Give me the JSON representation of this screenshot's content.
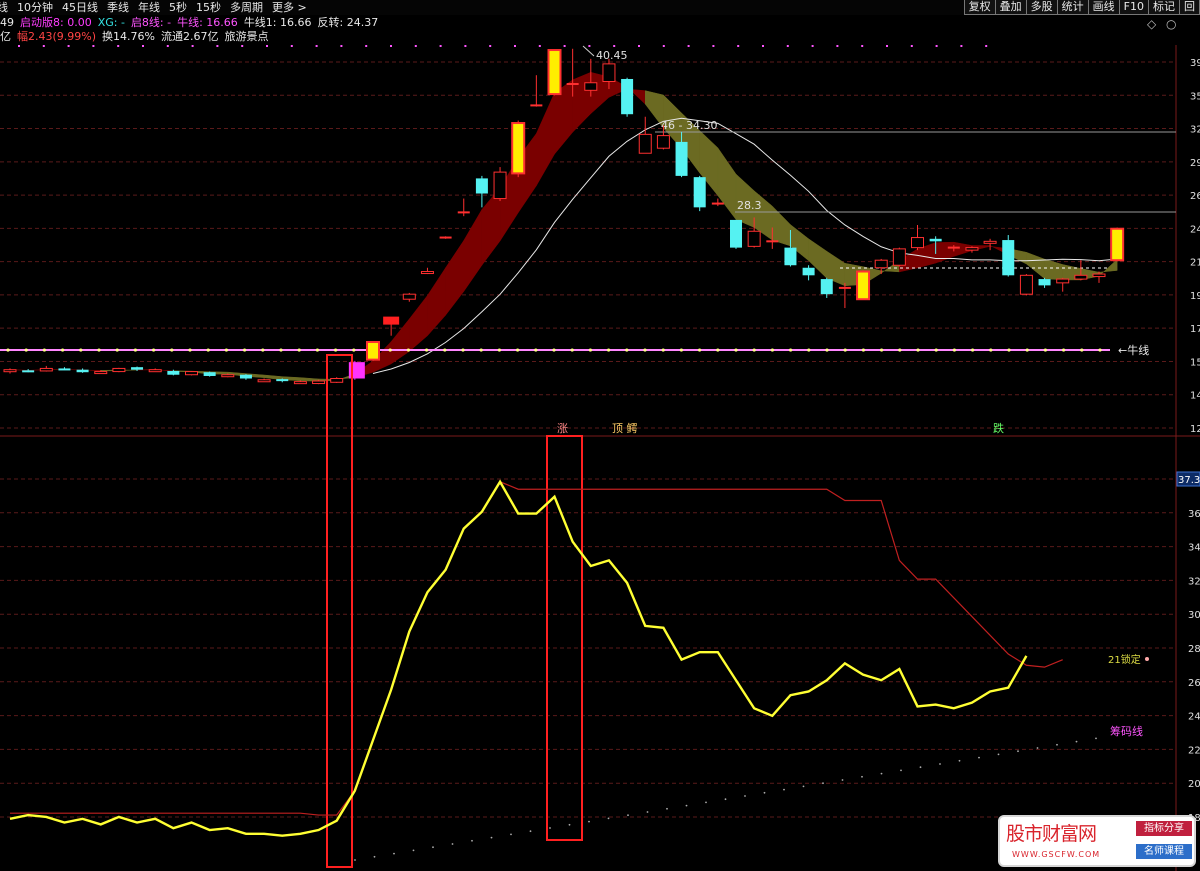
{
  "toolbar": {
    "tabs": [
      "线",
      "10分钟",
      "45日线",
      "季线",
      "年线",
      "5秒",
      "15秒",
      "多周期",
      "更多 >"
    ],
    "right_buttons": [
      "复权",
      "叠加",
      "多股",
      "统计",
      "画线",
      "F10",
      "标记",
      "回"
    ]
  },
  "info_line1": [
    {
      "text": "49",
      "color": "#e8e8e8"
    },
    {
      "text": "启动版8: 0.00",
      "color": "#ff3dff"
    },
    {
      "text": "XG: -",
      "color": "#33e0e0"
    },
    {
      "text": "启8线: -",
      "color": "#ff55ff"
    },
    {
      "text": "牛线: 16.66",
      "color": "#ff55ff"
    },
    {
      "text": "牛线1: 16.66",
      "color": "#e8e8e8"
    },
    {
      "text": "反转: 24.37",
      "color": "#e8e8e8"
    }
  ],
  "info_line2": [
    {
      "text": "亿",
      "color": "#e8e8e8"
    },
    {
      "text": "幅2.43(9.99%)",
      "color": "#ff4444"
    },
    {
      "text": "换14.76%",
      "color": "#e8e8e8"
    },
    {
      "text": "流通2.67亿",
      "color": "#e8e8e8"
    },
    {
      "text": "旅游景点",
      "color": "#e8e8e8"
    }
  ],
  "annotations": {
    "high_label": "40.45",
    "resistance_label": "46 - 34.30",
    "mid_label": "28.3",
    "bull_line_label": "←牛线",
    "signal_up": "涨",
    "signal_mid": "顶 鳄",
    "signal_down": "跌",
    "chip_line_label": "筹码线",
    "current_value_label": "37.3",
    "osc_end_label": "21锁定"
  },
  "price_axis_labels": [
    "39",
    "35",
    "32",
    "29",
    "26",
    "24",
    "21",
    "19",
    "17",
    "15",
    "14",
    "12"
  ],
  "osc_axis_labels": [
    "37.3",
    "36",
    "34",
    "32",
    "30",
    "28",
    "26",
    "24",
    "22",
    "20",
    "18"
  ],
  "colors": {
    "bg": "#000000",
    "grid": "#5a1a1a",
    "up": "#ff3030",
    "down": "#55f2f2",
    "limit_up": "#ffee00",
    "osc_line": "#ffff33",
    "red_line": "#c02020",
    "bull_line": "#ff88ff",
    "ribbon_up": "#7a0000",
    "ribbon_down": "#6b6a22"
  },
  "chart_data": {
    "type": "candlestick",
    "ylim_price": [
      11.5,
      40.9
    ],
    "ylim_osc": [
      17.0,
      37.4
    ],
    "bull_line_value": 16.66,
    "reversal_value": 24.37,
    "candles": [
      {
        "o": 14.95,
        "c": 15.1,
        "h": 15.2,
        "l": 14.8
      },
      {
        "o": 15.05,
        "c": 15.0,
        "h": 15.15,
        "l": 14.9
      },
      {
        "o": 15.0,
        "c": 15.2,
        "h": 15.4,
        "l": 14.95
      },
      {
        "o": 15.2,
        "c": 15.15,
        "h": 15.3,
        "l": 15.1
      },
      {
        "o": 15.1,
        "c": 14.9,
        "h": 15.2,
        "l": 14.85
      },
      {
        "o": 14.9,
        "c": 14.95,
        "h": 15.05,
        "l": 14.8
      },
      {
        "o": 14.95,
        "c": 15.2,
        "h": 15.25,
        "l": 14.9
      },
      {
        "o": 15.3,
        "c": 15.1,
        "h": 15.35,
        "l": 15.0
      },
      {
        "o": 15.1,
        "c": 15.1,
        "h": 15.2,
        "l": 15.0
      },
      {
        "o": 15.0,
        "c": 14.7,
        "h": 15.1,
        "l": 14.65
      },
      {
        "o": 14.7,
        "c": 14.95,
        "h": 15.0,
        "l": 14.65
      },
      {
        "o": 14.9,
        "c": 14.6,
        "h": 14.95,
        "l": 14.55
      },
      {
        "o": 14.6,
        "c": 14.7,
        "h": 14.8,
        "l": 14.5
      },
      {
        "o": 14.7,
        "c": 14.4,
        "h": 14.75,
        "l": 14.3
      },
      {
        "o": 14.3,
        "c": 14.3,
        "h": 14.4,
        "l": 14.2
      },
      {
        "o": 14.35,
        "c": 14.2,
        "h": 14.4,
        "l": 14.1
      },
      {
        "o": 14.1,
        "c": 14.15,
        "h": 14.25,
        "l": 14.0
      },
      {
        "o": 14.0,
        "c": 14.2,
        "h": 14.3,
        "l": 13.95
      },
      {
        "o": 14.1,
        "c": 14.4,
        "h": 14.5,
        "l": 14.05
      },
      {
        "o": 14.4,
        "c": 15.7,
        "h": 15.8,
        "l": 14.3,
        "special": "magenta"
      },
      {
        "o": 15.9,
        "c": 17.3,
        "h": 17.3,
        "l": 15.8
      },
      {
        "o": 19.0,
        "c": 19.0,
        "h": 19.2,
        "l": 17.8,
        "special": "redblock"
      },
      {
        "o": 20.7,
        "c": 21.1,
        "h": 21.2,
        "l": 20.5
      },
      {
        "o": 22.9,
        "c": 22.9,
        "h": 23.2,
        "l": 22.7
      },
      {
        "o": 25.6,
        "c": 25.6,
        "h": 25.7,
        "l": 25.5,
        "special": "dash"
      },
      {
        "o": 27.6,
        "c": 27.6,
        "h": 28.7,
        "l": 27.3,
        "special": "dash"
      },
      {
        "o": 29.1,
        "c": 30.3,
        "h": 30.5,
        "l": 28.0,
        "down": true
      },
      {
        "o": 28.7,
        "c": 30.8,
        "h": 31.2,
        "l": 28.5
      },
      {
        "o": 30.7,
        "c": 34.7,
        "h": 34.9,
        "l": 30.4
      },
      {
        "o": 36.1,
        "c": 36.1,
        "h": 38.5,
        "l": 36.0,
        "special": "dash"
      },
      {
        "o": 37.0,
        "c": 40.5,
        "h": 40.5,
        "l": 36.9
      },
      {
        "o": 37.8,
        "c": 37.8,
        "h": 40.6,
        "l": 36.8,
        "special": "dash"
      },
      {
        "o": 37.3,
        "c": 37.9,
        "h": 39.8,
        "l": 36.8
      },
      {
        "o": 38.0,
        "c": 39.4,
        "h": 39.8,
        "l": 37.4
      },
      {
        "o": 38.2,
        "c": 35.4,
        "h": 38.3,
        "l": 35.2,
        "down": true
      },
      {
        "o": 32.3,
        "c": 33.8,
        "h": 35.2,
        "l": 32.3
      },
      {
        "o": 32.7,
        "c": 33.7,
        "h": 34.5,
        "l": 32.6
      },
      {
        "o": 33.2,
        "c": 30.5,
        "h": 34.0,
        "l": 30.4,
        "down": true
      },
      {
        "o": 30.4,
        "c": 28.0,
        "h": 30.5,
        "l": 27.7,
        "down": true
      },
      {
        "o": 28.3,
        "c": 28.3,
        "h": 28.7,
        "l": 28.1,
        "special": "dash"
      },
      {
        "o": 27.0,
        "c": 24.8,
        "h": 27.0,
        "l": 24.7,
        "down": true
      },
      {
        "o": 24.9,
        "c": 26.1,
        "h": 27.2,
        "l": 24.8
      },
      {
        "o": 25.3,
        "c": 25.3,
        "h": 26.4,
        "l": 24.7,
        "special": "dash"
      },
      {
        "o": 24.8,
        "c": 23.4,
        "h": 26.2,
        "l": 23.3,
        "down": true
      },
      {
        "o": 23.2,
        "c": 22.6,
        "h": 23.4,
        "l": 22.2,
        "down": true
      },
      {
        "o": 22.3,
        "c": 21.1,
        "h": 22.4,
        "l": 20.8,
        "down": true
      },
      {
        "o": 21.6,
        "c": 21.6,
        "h": 22.0,
        "l": 20.0,
        "special": "dash"
      },
      {
        "o": 20.7,
        "c": 22.9,
        "h": 23.0,
        "l": 20.7
      },
      {
        "o": 23.2,
        "c": 23.8,
        "h": 23.9,
        "l": 22.7
      },
      {
        "o": 23.4,
        "c": 24.7,
        "h": 24.8,
        "l": 23.3
      },
      {
        "o": 24.8,
        "c": 25.6,
        "h": 26.6,
        "l": 24.6
      },
      {
        "o": 25.5,
        "c": 25.3,
        "h": 25.7,
        "l": 24.3,
        "down": true
      },
      {
        "o": 24.8,
        "c": 24.8,
        "h": 25.0,
        "l": 24.5,
        "special": "dash"
      },
      {
        "o": 24.6,
        "c": 24.8,
        "h": 24.9,
        "l": 24.4
      },
      {
        "o": 25.3,
        "c": 25.3,
        "h": 25.5,
        "l": 24.6
      },
      {
        "o": 25.4,
        "c": 22.6,
        "h": 25.8,
        "l": 22.5,
        "down": true
      },
      {
        "o": 21.1,
        "c": 22.6,
        "h": 22.7,
        "l": 21.0
      },
      {
        "o": 22.3,
        "c": 21.8,
        "h": 22.4,
        "l": 21.6,
        "down": true
      },
      {
        "o": 22.0,
        "c": 22.3,
        "h": 22.4,
        "l": 21.3
      },
      {
        "o": 22.3,
        "c": 22.6,
        "h": 23.8,
        "l": 22.2
      },
      {
        "o": 22.5,
        "c": 22.7,
        "h": 22.9,
        "l": 22.0
      },
      {
        "o": 23.8,
        "c": 26.3,
        "h": 26.4,
        "l": 23.7
      }
    ],
    "osc_line": [
      19.2,
      19.4,
      19.3,
      19.0,
      19.2,
      18.9,
      19.3,
      19.0,
      19.2,
      18.7,
      19.0,
      18.6,
      18.7,
      18.4,
      18.4,
      18.3,
      18.4,
      18.6,
      19.1,
      20.7,
      23.4,
      26.1,
      29.2,
      31.3,
      32.5,
      34.7,
      35.6,
      37.2,
      35.5,
      35.5,
      36.4,
      34.0,
      32.7,
      33.0,
      31.8,
      29.5,
      29.4,
      27.7,
      28.1,
      28.1,
      26.6,
      25.1,
      24.7,
      25.8,
      26.0,
      26.6,
      27.5,
      26.9,
      26.6,
      27.2,
      25.2,
      25.3,
      25.1,
      25.4,
      26.0,
      26.2,
      27.9
    ],
    "red_line": [
      19.5,
      19.5,
      19.5,
      19.5,
      19.5,
      19.5,
      19.5,
      19.5,
      19.5,
      19.5,
      19.5,
      19.5,
      19.5,
      19.5,
      19.5,
      19.5,
      19.5,
      19.4,
      19.4,
      20.7,
      23.4,
      26.1,
      29.2,
      31.3,
      32.5,
      34.7,
      35.6,
      37.2,
      36.8,
      36.8,
      36.8,
      36.8,
      36.8,
      36.8,
      36.8,
      36.8,
      36.8,
      36.8,
      36.8,
      36.8,
      36.8,
      36.8,
      36.8,
      36.8,
      36.8,
      36.8,
      36.2,
      36.2,
      36.2,
      33.0,
      32.0,
      32.0,
      31.0,
      30.0,
      29.0,
      28.0,
      27.4,
      27.3,
      27.7
    ]
  },
  "watermark": {
    "title": "股市财富网",
    "url": "WWW.GSCFW.COM",
    "tag1": "指标分享",
    "tag2": "名师课程"
  }
}
